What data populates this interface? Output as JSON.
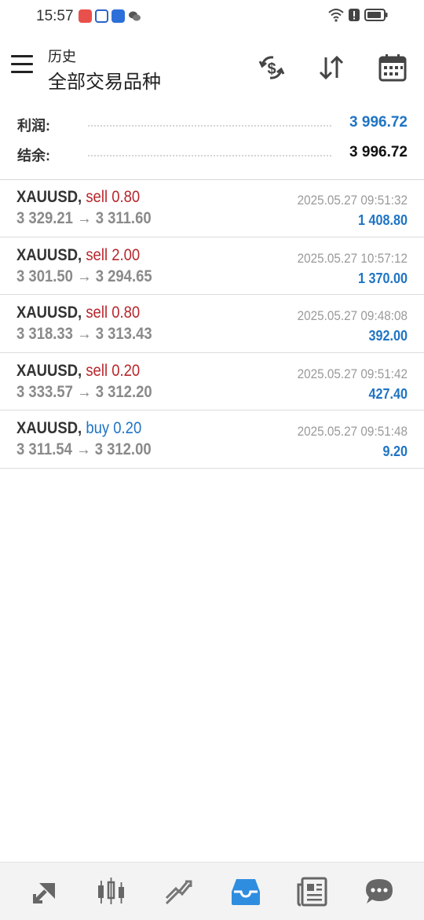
{
  "status": {
    "time": "15:57"
  },
  "header": {
    "title_small": "历史",
    "title_big": "全部交易品种"
  },
  "summary": [
    {
      "label": "利润:",
      "value": "3 996.72",
      "color": "#1f74c4"
    },
    {
      "label": "结余:",
      "value": "3 996.72",
      "color": "#111111"
    }
  ],
  "trades": [
    {
      "symbol": "XAUUSD,",
      "side": "sell",
      "volume": "0.80",
      "open": "3 329.21",
      "close": "3 311.60",
      "time": "2025.05.27 09:51:32",
      "profit": "1 408.80"
    },
    {
      "symbol": "XAUUSD,",
      "side": "sell",
      "volume": "2.00",
      "open": "3 301.50",
      "close": "3 294.65",
      "time": "2025.05.27 10:57:12",
      "profit": "1 370.00"
    },
    {
      "symbol": "XAUUSD,",
      "side": "sell",
      "volume": "0.80",
      "open": "3 318.33",
      "close": "3 313.43",
      "time": "2025.05.27 09:48:08",
      "profit": "392.00"
    },
    {
      "symbol": "XAUUSD,",
      "side": "sell",
      "volume": "0.20",
      "open": "3 333.57",
      "close": "3 312.20",
      "time": "2025.05.27 09:51:42",
      "profit": "427.40"
    },
    {
      "symbol": "XAUUSD,",
      "side": "buy",
      "volume": "0.20",
      "open": "3 311.54",
      "close": "3 312.00",
      "time": "2025.05.27 09:51:48",
      "profit": "9.20"
    }
  ],
  "colors": {
    "sell": "#b8262c",
    "buy": "#1f74c4",
    "profit": "#1f74c4",
    "active_nav": "#2f8de0"
  },
  "nav": [
    "quotes-icon",
    "chart-icon",
    "trade-icon",
    "history-icon",
    "news-icon",
    "chat-icon"
  ]
}
